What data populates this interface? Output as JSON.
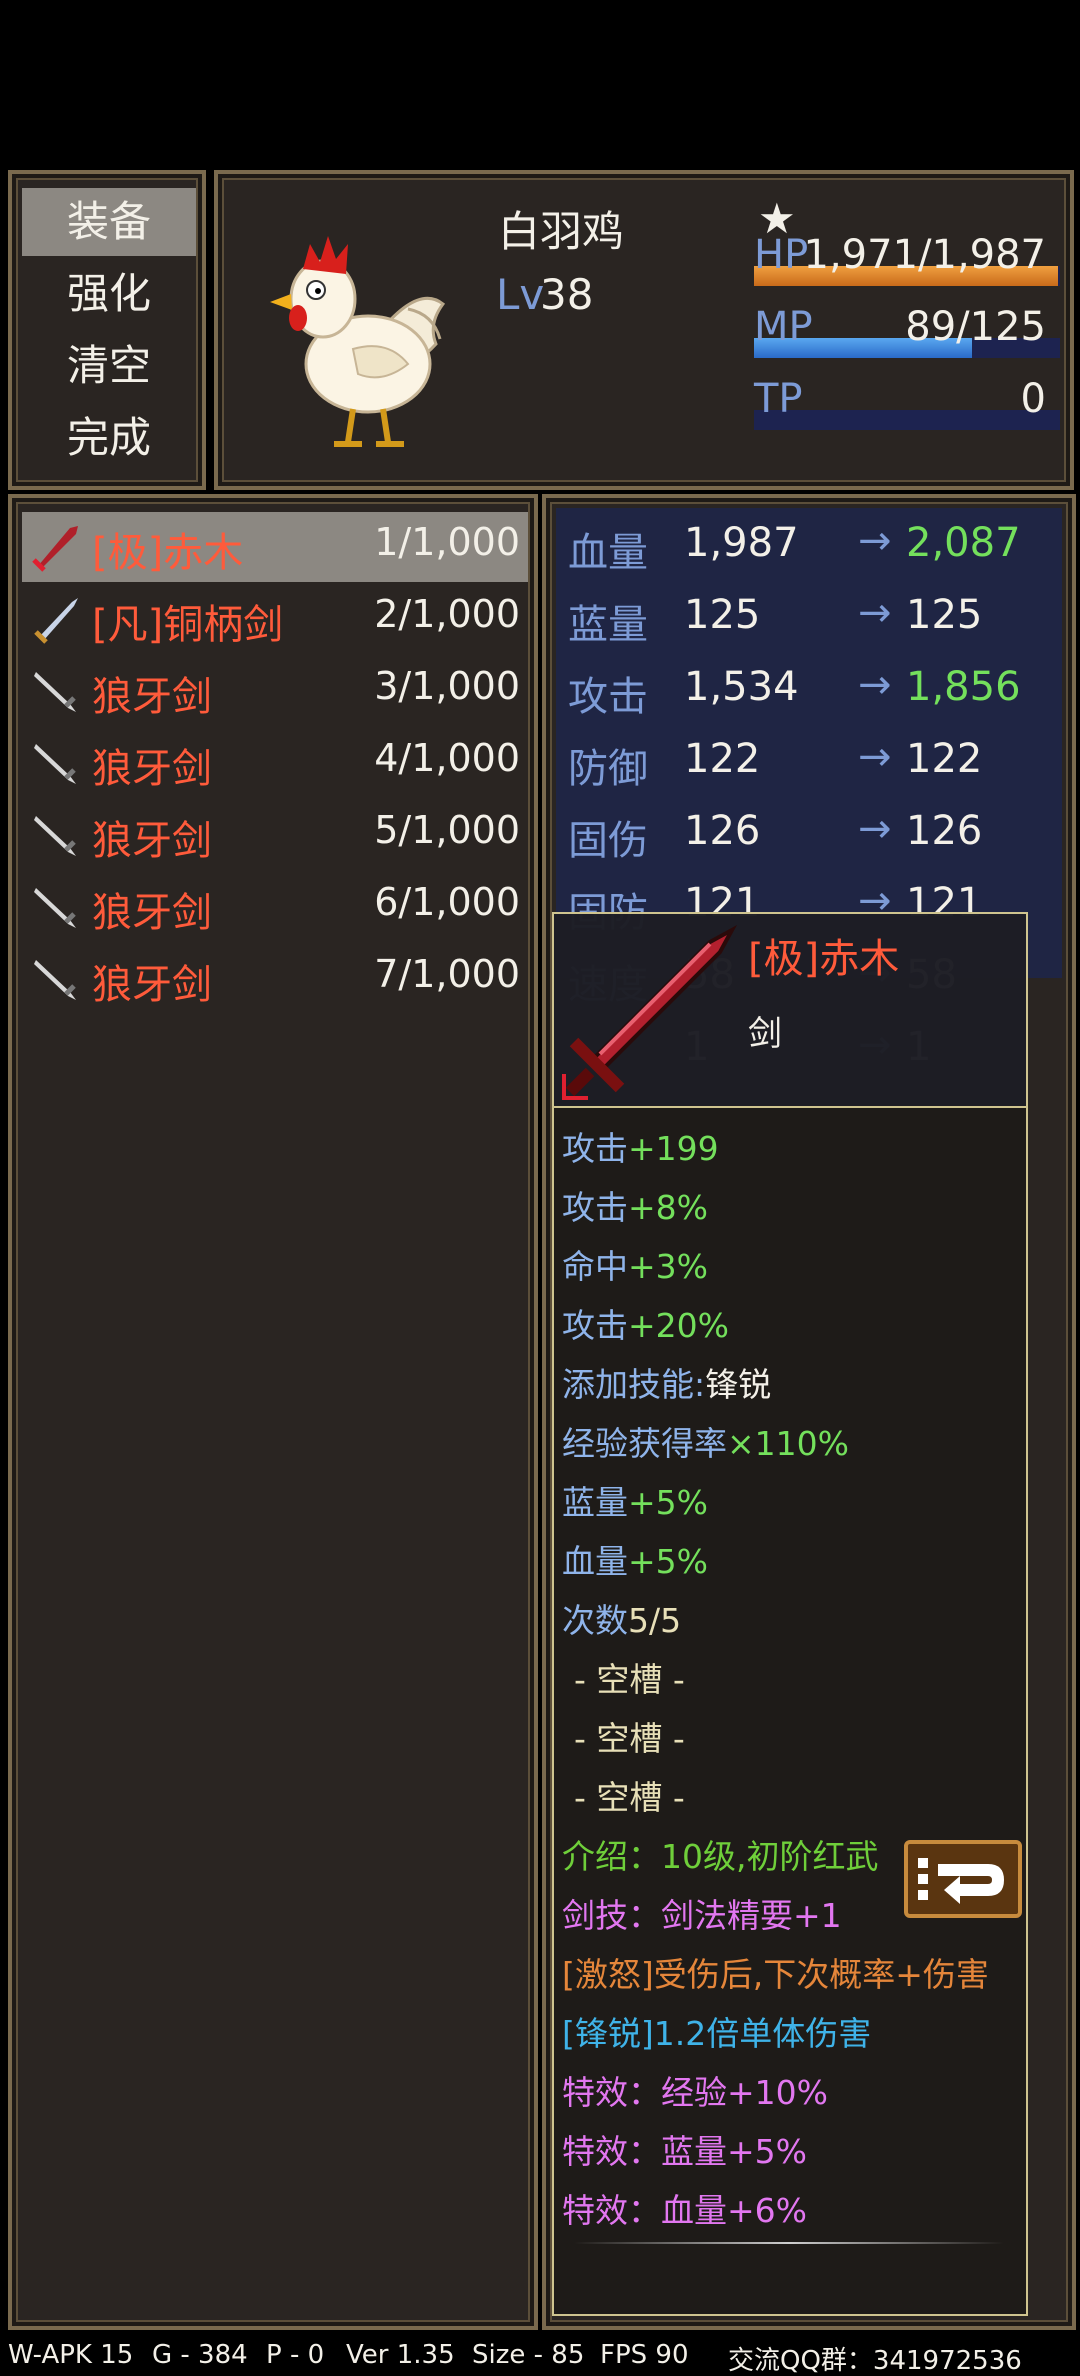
{
  "menu": {
    "items": [
      {
        "label": "装备",
        "selected": true
      },
      {
        "label": "强化",
        "selected": false
      },
      {
        "label": "清空",
        "selected": false
      },
      {
        "label": "完成",
        "selected": false
      }
    ]
  },
  "character": {
    "name": "白羽鸡",
    "star": "★",
    "lv_label": "Lv",
    "lv": "38",
    "hp_label": "HP",
    "hp_text": "1,971/1,987",
    "hp_ratio": 0.992,
    "mp_label": "MP",
    "mp_text": "89/125",
    "mp_ratio": 0.712,
    "tp_label": "TP",
    "tp_text": "0",
    "tp_ratio": 0
  },
  "equipment_list": [
    {
      "name": "[极]赤木",
      "count": "1/1,000",
      "icon": "red-sword-icon",
      "selected": true
    },
    {
      "name": "[凡]铜柄剑",
      "count": "2/1,000",
      "icon": "copper-sword-icon",
      "selected": false
    },
    {
      "name": "狼牙剑",
      "count": "3/1,000",
      "icon": "fang-sword-icon",
      "selected": false
    },
    {
      "name": "狼牙剑",
      "count": "4/1,000",
      "icon": "fang-sword-icon",
      "selected": false
    },
    {
      "name": "狼牙剑",
      "count": "5/1,000",
      "icon": "fang-sword-icon",
      "selected": false
    },
    {
      "name": "狼牙剑",
      "count": "6/1,000",
      "icon": "fang-sword-icon",
      "selected": false
    },
    {
      "name": "狼牙剑",
      "count": "7/1,000",
      "icon": "fang-sword-icon",
      "selected": false
    }
  ],
  "stats": {
    "arrow": "→",
    "rows": [
      {
        "label": "血量",
        "current": "1,987",
        "next": "2,087",
        "up": true
      },
      {
        "label": "蓝量",
        "current": "125",
        "next": "125",
        "up": false
      },
      {
        "label": "攻击",
        "current": "1,534",
        "next": "1,856",
        "up": true
      },
      {
        "label": "防御",
        "current": "122",
        "next": "122",
        "up": false
      },
      {
        "label": "固伤",
        "current": "126",
        "next": "126",
        "up": false
      },
      {
        "label": "固防",
        "current": "121",
        "next": "121",
        "up": false
      },
      {
        "label": "速度",
        "current": "58",
        "next": "58",
        "up": false
      },
      {
        "label": "",
        "current": "1",
        "next": "1",
        "up": false
      }
    ]
  },
  "detail": {
    "name": "[极]赤木",
    "type": "剑",
    "lines": [
      {
        "label": "攻击",
        "value": "+199"
      },
      {
        "label": "攻击",
        "value": "+8%"
      },
      {
        "label": "命中",
        "value": "+3%"
      },
      {
        "label": "攻击",
        "value": "+20%"
      },
      {
        "label": "添加技能:",
        "value": "锋锐"
      },
      {
        "label": "经验获得率",
        "value": "×110%"
      },
      {
        "label": "蓝量",
        "value": "+5%"
      },
      {
        "label": "血量",
        "value": "+5%"
      },
      {
        "label": "次数",
        "value": "5/5"
      }
    ],
    "slots": [
      "- 空槽 -",
      "- 空槽 -",
      "- 空槽 -"
    ],
    "intro": "介绍：10级,初阶红武",
    "skill": "剑技：剑法精要+1",
    "rage_tag": "[激怒]",
    "rage_text": "受伤后,下次概率+伤害",
    "sharp_tag": "[锋锐]",
    "sharp_text": "1.2倍单体伤害",
    "effects": [
      "特效：经验+10%",
      "特效：蓝量+5%",
      "特效：血量+6%"
    ]
  },
  "footer": {
    "apk": "W-APK 15",
    "g": "G - 384",
    "p": "P - 0",
    "ver": "Ver 1.35",
    "size": "Size - 85",
    "fps": "FPS 90",
    "qq": "交流QQ群：341972536"
  },
  "colors": {
    "item_name": "#ff5b3b",
    "stat_up": "#74e05c",
    "label_blue": "#7d9bd6",
    "hp_bar": "#e08b2a",
    "mp_bar": "#3e8fe0"
  }
}
